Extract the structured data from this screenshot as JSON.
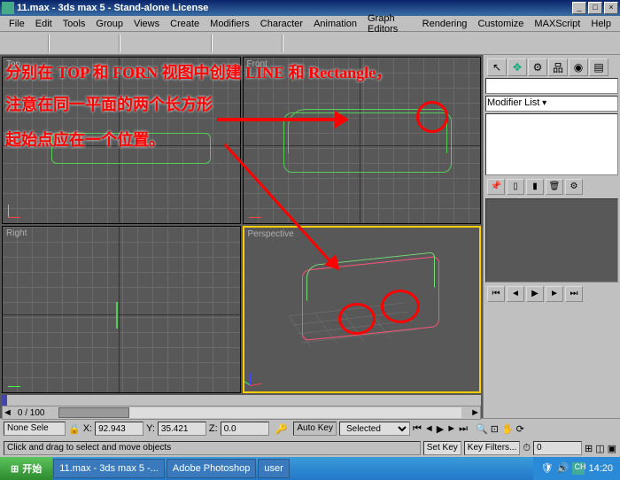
{
  "title": "11.max - 3ds max 5 - Stand-alone License",
  "menus": [
    "File",
    "Edit",
    "Tools",
    "Group",
    "Views",
    "Create",
    "Modifiers",
    "Character",
    "Animation",
    "Graph Editors",
    "Rendering",
    "Customize",
    "MAXScript",
    "Help"
  ],
  "viewports": {
    "tl": "Top",
    "tr": "Front",
    "bl": "Right",
    "br": "Perspective"
  },
  "rightpanel": {
    "dropdown": "Modifier List"
  },
  "timeline": {
    "frames": "0 / 100"
  },
  "status": {
    "sel": "None Sele",
    "xlabel": "X:",
    "x": "92.943",
    "ylabel": "Y:",
    "y": "35.421",
    "zlabel": "Z:",
    "z": "0.0",
    "autokey": "Auto Key",
    "setkey": "Set Key",
    "selscope": "Selected",
    "filters": "Key Filters...",
    "hint": "Click and drag to select and move objects"
  },
  "taskbar": {
    "start": "开始",
    "items": [
      "11.max - 3ds max 5 -...",
      "Adobe Photoshop",
      "user"
    ],
    "time": "14:20"
  },
  "annotations": {
    "l1": "分别在 TOP 和 FORN 视图中创建 LINE 和 Rectangle，",
    "l2": "注意在同一平面的两个长方形",
    "l3": "起始点应在一个位置。"
  }
}
